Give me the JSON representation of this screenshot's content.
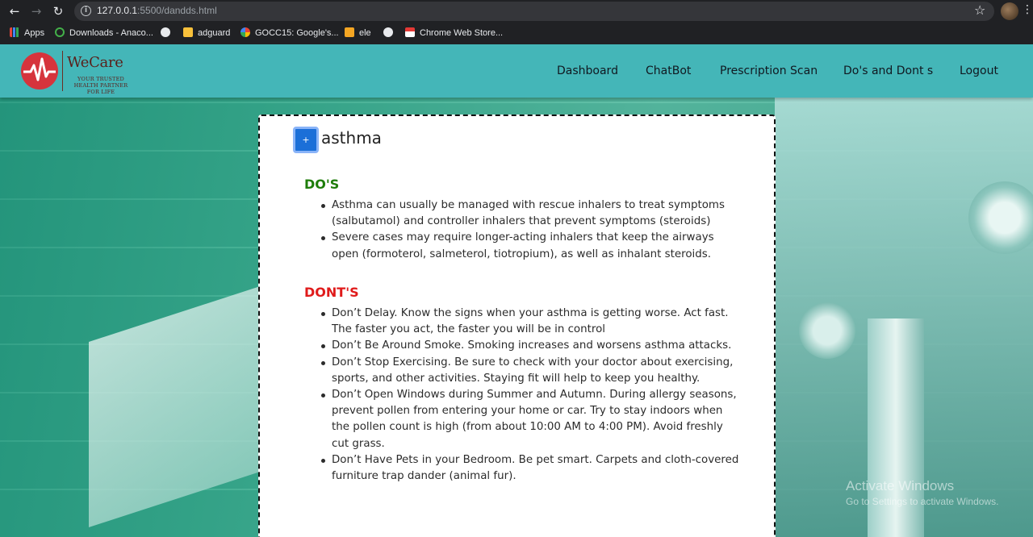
{
  "browser": {
    "url_host": "127.0.0.1",
    "url_path": ":5500/dandds.html",
    "bookmarks": [
      {
        "label": "Apps",
        "icon": "apps-grid-icon"
      },
      {
        "label": "Downloads - Anaco...",
        "icon": "anaconda-icon"
      },
      {
        "label": "",
        "icon": "globe-icon"
      },
      {
        "label": "adguard",
        "icon": "adguard-icon"
      },
      {
        "label": "GOCC15: Google's...",
        "icon": "google-icon"
      },
      {
        "label": "ele",
        "icon": "ele-icon"
      },
      {
        "label": "",
        "icon": "globe-icon"
      },
      {
        "label": "Chrome Web Store...",
        "icon": "chrome-web-store-icon"
      }
    ]
  },
  "brand": {
    "name": "WeCare",
    "tagline": "Your Trusted Health Partner For Life",
    "colors": {
      "navbar": "#44b6b8",
      "logo_red": "#d6343c",
      "logo_text": "#5a1f1a"
    }
  },
  "nav": {
    "links": [
      "Dashboard",
      "ChatBot",
      "Prescription Scan",
      "Do's and Dont s",
      "Logout"
    ]
  },
  "card": {
    "add_label": "+",
    "disease": "asthma",
    "dos_title": "DO'S",
    "dos": [
      "Asthma can usually be managed with rescue inhalers to treat symptoms (salbutamol) and controller inhalers that prevent symptoms (steroids)",
      "Severe cases may require longer-acting inhalers that keep the airways open (formoterol, salmeterol, tiotropium), as well as inhalant steroids."
    ],
    "donts_title": "DONT'S",
    "donts": [
      "Don’t Delay. Know the signs when your asthma is getting worse. Act fast. The faster you act, the faster you will be in control",
      "Don’t Be Around Smoke. Smoking increases and worsens asthma attacks.",
      "Don’t Stop Exercising. Be sure to check with your doctor about exercising, sports, and other activities. Staying fit will help to keep you healthy.",
      "Don’t Open Windows during Summer and Autumn. During allergy seasons, prevent pollen from entering your home or car. Try to stay indoors when the pollen count is high (from about 10:00 AM to 4:00 PM). Avoid freshly cut grass.",
      "Don’t Have Pets in your Bedroom. Be pet smart. Carpets and cloth-covered furniture trap dander (animal fur)."
    ],
    "colors": {
      "dos": "#1e7d0a",
      "donts": "#e01b1b",
      "add_button": "#1b6fd8"
    }
  },
  "watermark": {
    "line1": "Activate Windows",
    "line2": "Go to Settings to activate Windows."
  }
}
